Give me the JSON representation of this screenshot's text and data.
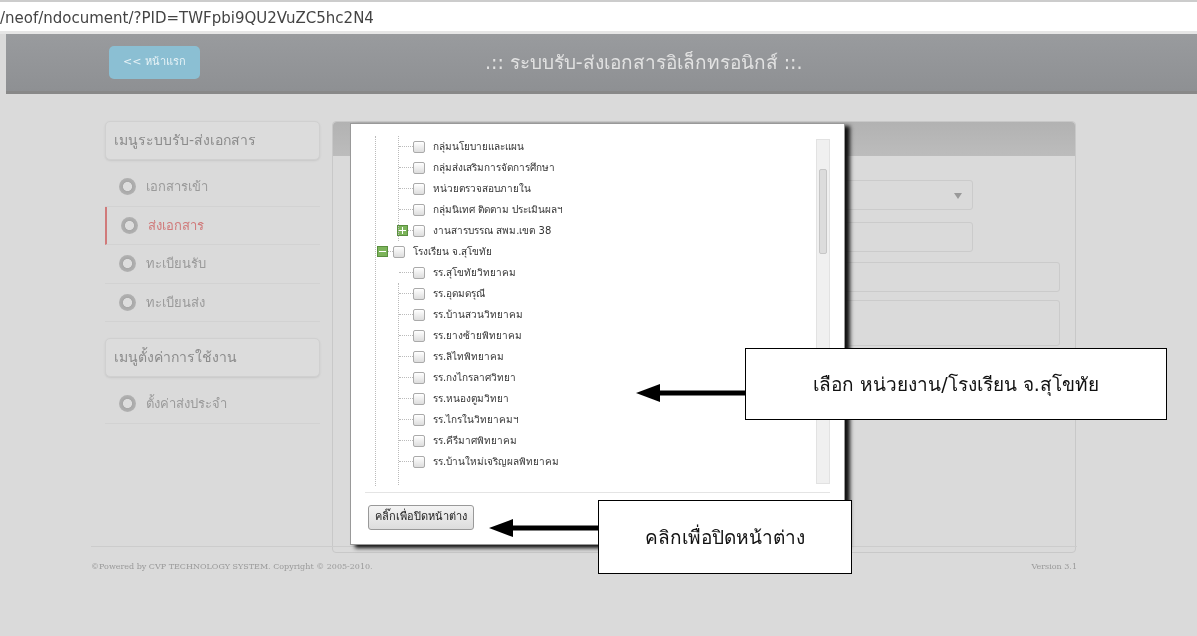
{
  "address_bar": {
    "url": "/neof/ndocument/?PID=TWFpbi9QU2VuZC5hc2N4"
  },
  "header": {
    "home_button": "<< หน้าแรก",
    "title": ".:: ระบบรับ-ส่งเอกสารอิเล็กทรอนิกส์ ::."
  },
  "sidebar": {
    "sections": [
      {
        "heading": "เมนูระบบรับ-ส่งเอกสาร",
        "items": [
          {
            "label": "เอกสารเข้า",
            "selected": false
          },
          {
            "label": "ส่งเอกสาร",
            "selected": true
          },
          {
            "label": "ทะเบียนรับ",
            "selected": false
          },
          {
            "label": "ทะเบียนส่ง",
            "selected": false
          }
        ]
      },
      {
        "heading": "เมนูตั้งค่าการใช้งาน",
        "items": [
          {
            "label": "ตั้งค่าส่งประจำ",
            "selected": false
          }
        ]
      }
    ]
  },
  "dialog": {
    "tree": [
      {
        "children": [
          {
            "label": "กลุ่มนโยบายและแผน",
            "checked": false
          },
          {
            "label": "กลุ่มส่งเสริมการจัดการศึกษา",
            "checked": false
          },
          {
            "label": "หน่วยตรวจสอบภายใน",
            "checked": false
          },
          {
            "label": "กลุ่มนิเทศ ติดตาม ประเมินผลฯ",
            "checked": false
          },
          {
            "label": "งานสารบรรณ สพม.เขต 38",
            "checked": false,
            "expanded": false
          }
        ]
      },
      {
        "label": "โรงเรียน จ.สุโขทัย",
        "checked": false,
        "expanded": true,
        "children": [
          {
            "label": "รร.สุโขทัยวิทยาคม",
            "checked": false
          },
          {
            "label": "รร.อุดมดรุณี",
            "checked": false
          },
          {
            "label": "รร.บ้านสวนวิทยาคม",
            "checked": false
          },
          {
            "label": "รร.ยางซ้ายพิทยาคม",
            "checked": false
          },
          {
            "label": "รร.ลิไทพิทยาคม",
            "checked": false
          },
          {
            "label": "รร.กงไกรลาศวิทยา",
            "checked": false
          },
          {
            "label": "รร.หนองตูมวิทยา",
            "checked": false
          },
          {
            "label": "รร.ไกรในวิทยาคมฯ",
            "checked": false
          },
          {
            "label": "รร.คีรีมาศพิทยาคม",
            "checked": false
          },
          {
            "label": "รร.บ้านใหม่เจริญผลพิทยาคม",
            "checked": false
          }
        ]
      }
    ],
    "close_button": "คลิ๊กเพื่อปิดหน้าต่าง"
  },
  "callouts": [
    {
      "text": "เลือก หน่วยงาน/โรงเรียน จ.สุโขทัย"
    },
    {
      "text": "คลิกเพื่อปิดหน้าต่าง"
    }
  ],
  "footer": {
    "copyright": "©Powered by CVP TECHNOLOGY SYSTEM. Copyright © 2005-2010.",
    "version": "Version 3.1"
  }
}
